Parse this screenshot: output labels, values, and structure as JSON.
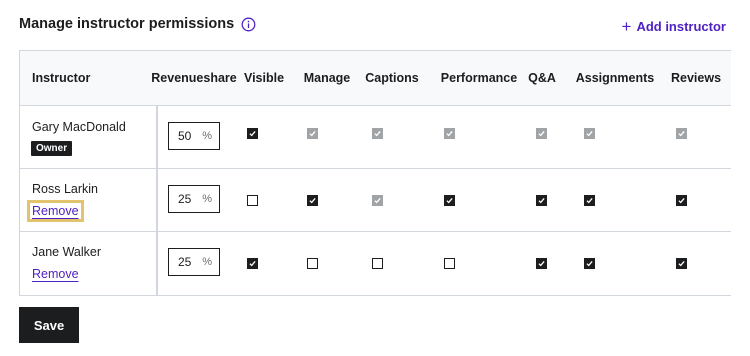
{
  "header": {
    "title": "Manage instructor permissions",
    "info_icon": "info-icon",
    "add_label": "Add instructor",
    "add_icon": "plus-icon"
  },
  "columns": {
    "instructor": "Instructor",
    "revenue_line1": "Revenue",
    "revenue_line2": "share",
    "permissions": [
      "Visible",
      "Manage",
      "Captions",
      "Performance",
      "Q&A",
      "Assignments",
      "Reviews"
    ]
  },
  "rows": [
    {
      "name": "Gary MacDonald",
      "badge": "Owner",
      "revenue": "50",
      "unit": "%",
      "permissions": [
        "checked",
        "disabled",
        "disabled",
        "disabled",
        "disabled",
        "disabled",
        "disabled"
      ]
    },
    {
      "name": "Ross Larkin",
      "remove_label": "Remove",
      "revenue": "25",
      "unit": "%",
      "permissions": [
        "unchecked",
        "checked",
        "disabled",
        "checked",
        "checked",
        "checked",
        "checked"
      ]
    },
    {
      "name": "Jane Walker",
      "remove_label": "Remove",
      "revenue": "25",
      "unit": "%",
      "permissions": [
        "checked",
        "unchecked",
        "unchecked",
        "unchecked",
        "checked",
        "checked",
        "checked"
      ]
    }
  ],
  "footer": {
    "save_label": "Save"
  },
  "colors": {
    "accent": "#5022c3",
    "dark": "#1c1d1f",
    "focus": "#e2c36f",
    "disabled": "#a1a4a7"
  }
}
